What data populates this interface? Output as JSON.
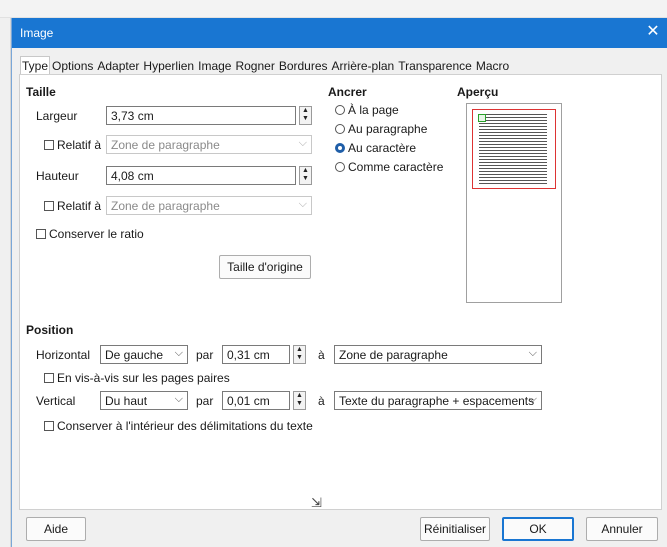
{
  "window": {
    "title": "Image"
  },
  "tabs": [
    "Type",
    "Options",
    "Adapter",
    "Hyperlien",
    "Image",
    "Rogner",
    "Bordures",
    "Arrière-plan",
    "Transparence",
    "Macro"
  ],
  "size": {
    "heading": "Taille",
    "width_label": "Largeur",
    "width_value": "3,73 cm",
    "width_relative_label": "Relatif à",
    "width_relative_value": "Zone de paragraphe",
    "height_label": "Hauteur",
    "height_value": "4,08 cm",
    "height_relative_label": "Relatif à",
    "height_relative_value": "Zone de paragraphe",
    "keep_ratio_label": "Conserver le ratio",
    "original_size_label": "Taille d'origine"
  },
  "anchor": {
    "heading": "Ancrer",
    "options": [
      "À la page",
      "Au paragraphe",
      "Au caractère",
      "Comme caractère"
    ],
    "selected": "Au caractère"
  },
  "preview": {
    "heading": "Aperçu"
  },
  "position": {
    "heading": "Position",
    "horizontal_label": "Horizontal",
    "horizontal_value": "De gauche",
    "horizontal_by_label": "par",
    "horizontal_by_value": "0,31 cm",
    "horizontal_to_label": "à",
    "horizontal_to_value": "Zone de paragraphe",
    "mirror_label": "En vis-à-vis sur les pages paires",
    "vertical_label": "Vertical",
    "vertical_value": "Du haut",
    "vertical_by_label": "par",
    "vertical_by_value": "0,01 cm",
    "vertical_to_label": "à",
    "vertical_to_value": "Texte du paragraphe + espacements",
    "keep_inside_label": "Conserver à l'intérieur des délimitations du texte"
  },
  "buttons": {
    "help": "Aide",
    "reset": "Réinitialiser",
    "ok": "OK",
    "cancel": "Annuler"
  },
  "colors": {
    "titlebar": "#1976d2",
    "primary_border": "#1976d2",
    "preview_page": "#dd3333",
    "preview_frame": "#2aa12a"
  }
}
